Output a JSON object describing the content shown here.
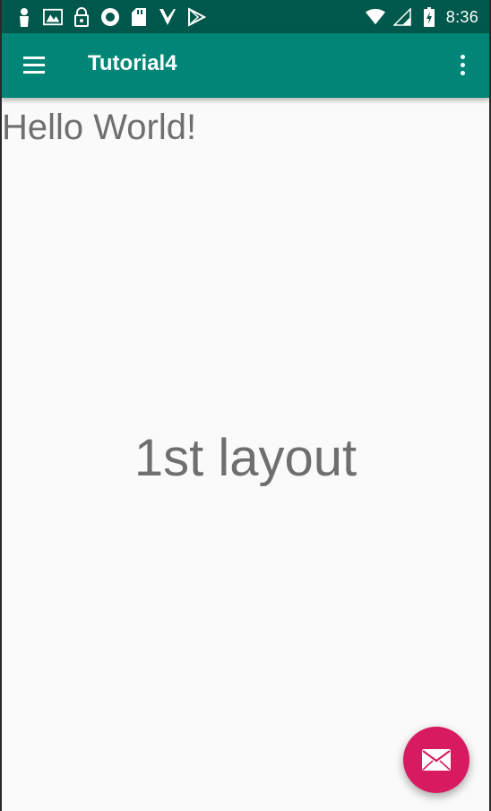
{
  "status_bar": {
    "time": "8:36",
    "left_icons": [
      "person-icon",
      "gallery-icon",
      "lock-icon",
      "record-icon",
      "sd-card-icon",
      "download-icon",
      "play-store-icon"
    ],
    "right_icons": [
      "wifi-icon",
      "signal-icon",
      "battery-icon"
    ]
  },
  "app_bar": {
    "title": "Tutorial4",
    "menu_icon": "hamburger-menu-icon",
    "overflow_icon": "more-vert-icon"
  },
  "content": {
    "hello_text": "Hello World!",
    "center_text": "1st layout"
  },
  "fab": {
    "icon": "email-icon",
    "color": "#d81b60"
  },
  "colors": {
    "status_bar": "#00574b",
    "app_bar": "#008577",
    "background": "#fafafa",
    "text": "#6f6f6f"
  }
}
